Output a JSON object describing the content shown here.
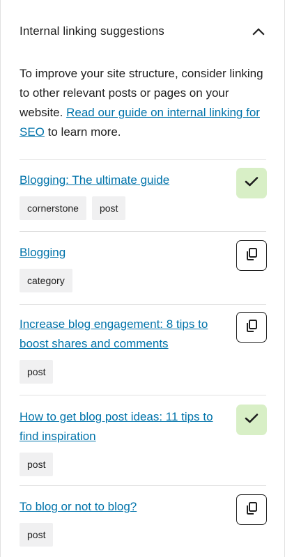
{
  "panel": {
    "title": "Internal linking suggestions",
    "collapse_icon": "chevron-up-icon"
  },
  "intro": {
    "text_before": "To improve your site structure, consider linking to other relevant posts or pages on your website.",
    "link_text": "Read our guide on internal linking for SEO",
    "text_after": "to learn more."
  },
  "suggestions": [
    {
      "title": "Blogging: The ultimate guide",
      "tags": [
        "cornerstone",
        "post"
      ],
      "status": "linked",
      "icon": "check-icon"
    },
    {
      "title": "Blogging",
      "tags": [
        "category"
      ],
      "status": "copy",
      "icon": "copy-icon"
    },
    {
      "title": "Increase blog engagement: 8 tips to boost shares and comments",
      "tags": [
        "post"
      ],
      "status": "copy",
      "icon": "copy-icon"
    },
    {
      "title": "How to get blog post ideas: 11 tips to find inspiration",
      "tags": [
        "post"
      ],
      "status": "linked",
      "icon": "check-icon"
    },
    {
      "title": "To blog or not to blog?",
      "tags": [
        "post"
      ],
      "status": "copy",
      "icon": "copy-icon"
    }
  ],
  "colors": {
    "link": "#0073aa",
    "linked_bg": "#d8efc6",
    "check": "#1e1e1e",
    "tag_bg": "#f0f0f1",
    "divider": "#e0e0e0"
  }
}
